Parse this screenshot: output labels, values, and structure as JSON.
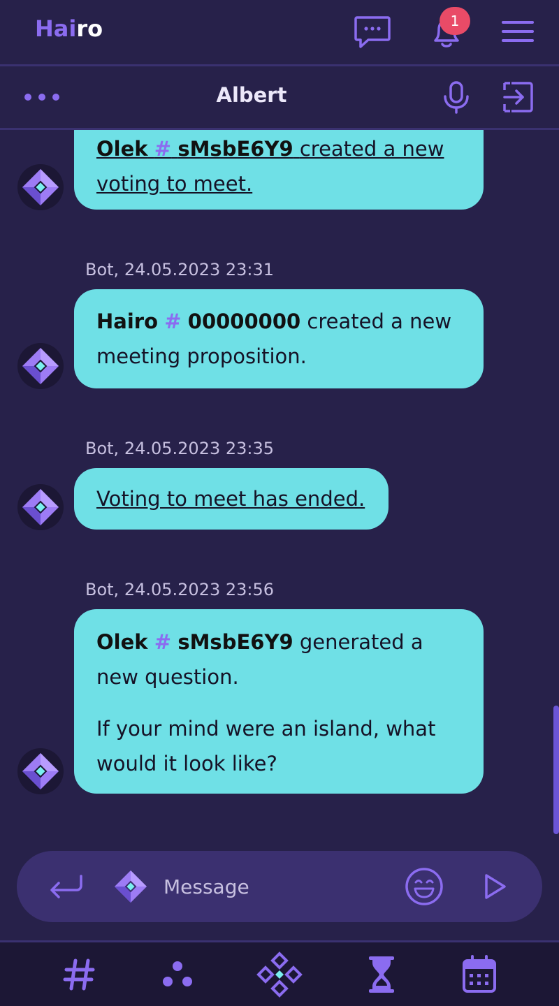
{
  "app": {
    "logo_part1": "Hai",
    "logo_part2": "ro",
    "notification_count": "1"
  },
  "chat": {
    "title": "Albert"
  },
  "messages": [
    {
      "sender": "",
      "timestamp": "",
      "user": "Olek",
      "hash": "#",
      "user_id": "sMsbE6Y9",
      "text": "created a new voting to meet."
    },
    {
      "meta": "Bot, 24.05.2023 23:31",
      "user": "Hairo",
      "hash": "#",
      "user_id": "00000000",
      "text_line1": "created a new",
      "text_line2": "meeting proposition."
    },
    {
      "meta": "Bot, 24.05.2023 23:35",
      "text": "Voting to meet has ended."
    },
    {
      "meta": "Bot, 24.05.2023 23:56",
      "user": "Olek",
      "hash": "#",
      "user_id": "sMsbE6Y9",
      "text_line1": "generated a",
      "text_line2": "new question.",
      "question_line1": "If your mind were an island, what",
      "question_line2": "would it look like?"
    }
  ],
  "composer": {
    "placeholder": "Message"
  },
  "colors": {
    "background": "#27214a",
    "accent": "#8b6cf0",
    "bubble": "#6fe0e6",
    "badge": "#e94b67"
  }
}
